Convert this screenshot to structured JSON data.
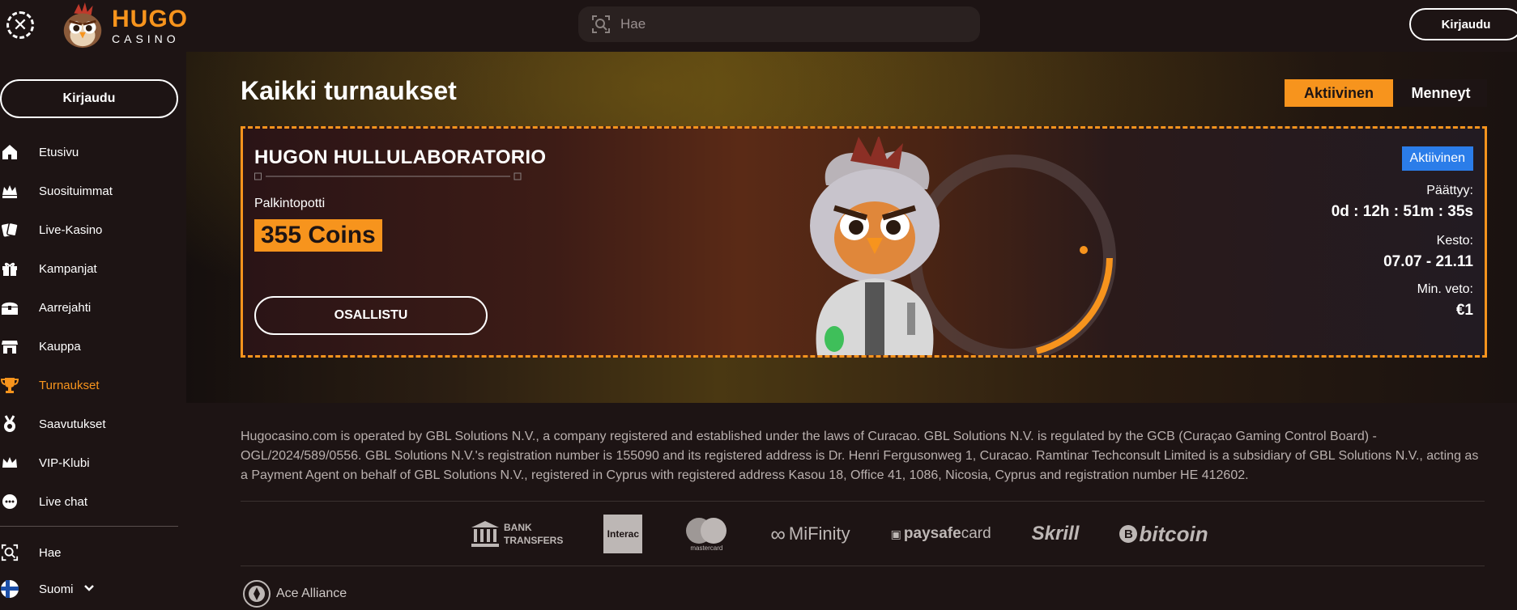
{
  "header": {
    "brand_name": "HUGO",
    "brand_sub": "CASINO",
    "search_placeholder": "Hae",
    "login_label": "Kirjaudu"
  },
  "sidebar": {
    "login_label": "Kirjaudu",
    "items": [
      {
        "label": "Etusivu",
        "icon": "home-icon"
      },
      {
        "label": "Suosituimmat",
        "icon": "crown-cards-icon"
      },
      {
        "label": "Live-Kasino",
        "icon": "cards-icon"
      },
      {
        "label": "Kampanjat",
        "icon": "gift-icon"
      },
      {
        "label": "Aarrejahti",
        "icon": "treasure-chest-icon"
      },
      {
        "label": "Kauppa",
        "icon": "shop-icon"
      },
      {
        "label": "Turnaukset",
        "icon": "trophy-icon",
        "active": true
      },
      {
        "label": "Saavutukset",
        "icon": "medal-icon"
      },
      {
        "label": "VIP-Klubi",
        "icon": "crown-icon"
      },
      {
        "label": "Live chat",
        "icon": "chat-icon"
      }
    ],
    "search_label": "Hae",
    "language_label": "Suomi"
  },
  "main": {
    "title": "Kaikki turnaukset",
    "tabs": {
      "active_label": "Aktiivinen",
      "past_label": "Menneyt"
    },
    "tournament": {
      "name": "HUGON HULLULABORATORIO",
      "prize_label": "Palkintopotti",
      "prize_value": "355 Coins",
      "join_label": "OSALLISTU",
      "status": "Aktiivinen",
      "ends_label": "Päättyy:",
      "ends_value": "0d : 12h : 51m : 35s",
      "duration_label": "Kesto:",
      "duration_value": "07.07 - 21.11",
      "min_bet_label": "Min. veto:",
      "min_bet_value": "€1"
    }
  },
  "footer": {
    "legal_text": "Hugocasino.com is operated by GBL Solutions N.V., a company registered and established under the laws of Curacao. GBL Solutions N.V. is regulated by the GCB (Curaçao Gaming Control Board) - OGL/2024/589/0556. GBL Solutions N.V.'s registration number is 155090 and its registered address is Dr. Henri Fergusonweg 1, Curacao. Ramtinar Techconsult Limited is a subsidiary of GBL Solutions N.V., acting as a Payment Agent on behalf of GBL Solutions N.V., registered in Cyprus with registered address Kasou 18, Office 41, 1086, Nicosia, Cyprus and registration number HE 412602.",
    "payments": {
      "bank_line1": "BANK",
      "bank_line2": "TRANSFERS",
      "interac": "Interac",
      "mastercard": "mastercard",
      "mifinity": "MiFinity",
      "paysafe_bold": "paysafe",
      "paysafe_light": "card",
      "skrill": "Skrill",
      "bitcoin": "bitcoin"
    },
    "alliance_label": "Ace Alliance"
  },
  "colors": {
    "accent": "#f7941d",
    "status_blue": "#2b7de9",
    "background": "#1d1414"
  }
}
